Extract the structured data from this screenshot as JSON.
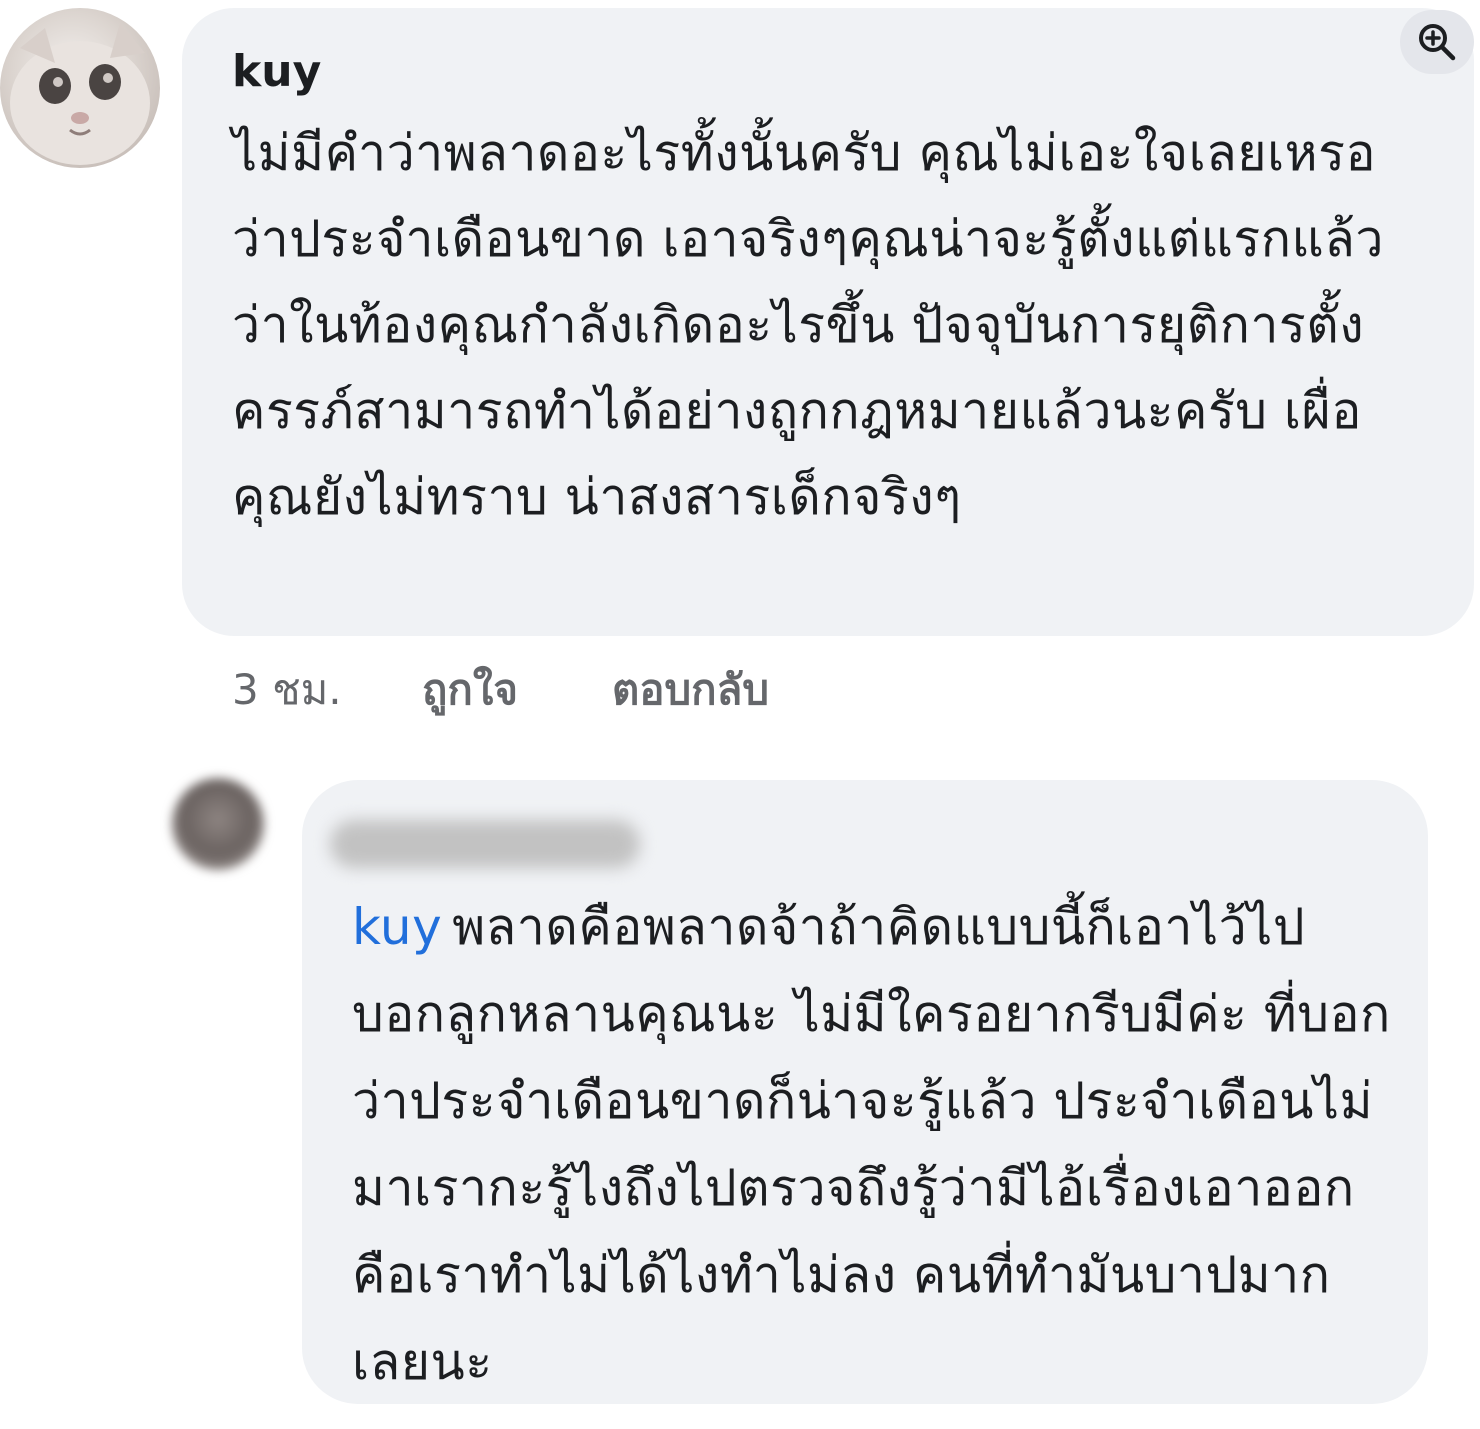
{
  "comments": [
    {
      "author": "kuy",
      "text": "ไม่มีคำว่าพลาดอะไรทั้งนั้นครับ คุณไม่เอะใจเลยเหรอว่าประจำเดือนขาด เอาจริงๆคุณน่าจะรู้ตั้งแต่แรกแล้วว่าในท้องคุณกำลังเกิดอะไรขึ้น ปัจจุบันการยุติการตั้งครรภ์สามารถทำได้อย่างถูกกฎหมายแล้วนะครับ เผื่อคุณยังไม่ทราบ น่าสงสารเด็กจริงๆ",
      "time": "3 ชม.",
      "like_label": "ถูกใจ",
      "reply_label": "ตอบกลับ"
    },
    {
      "mention": "kuy",
      "text": "พลาดคือพลาดจ้าถ้าคิดแบบนี้ก็เอาไว้ไปบอกลูกหลานคุณนะ ไม่มีใครอยากรีบมีค่ะ ที่บอกว่าประจำเดือนขาดก็น่าจะรู้แล้ว ประจำเดือนไม่มาเรากะรู้ไงถึงไปตรวจถึงรู้ว่ามีไอ้เรื่องเอาออกคือเราทำไม่ได้ไงทำไม่ลง คนที่ทำมันบาปมากเลยนะ"
    }
  ],
  "icons": {
    "zoom": "zoom-in-icon"
  },
  "colors": {
    "bubble": "#f0f2f5",
    "mention": "#216fdb",
    "meta": "#65676b"
  }
}
